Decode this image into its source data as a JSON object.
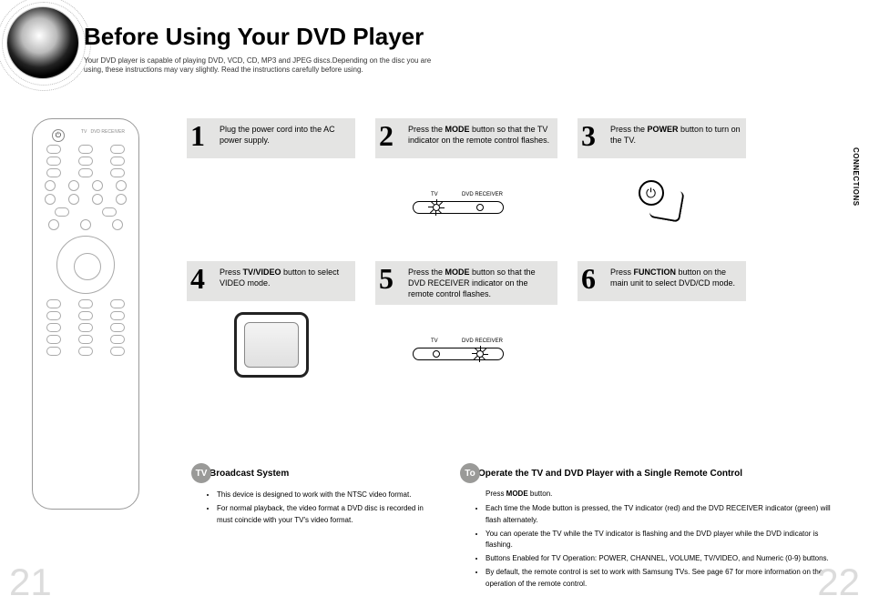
{
  "title": "Before Using Your DVD Player",
  "intro": "Your DVD player is capable of playing DVD, VCD, CD, MP3 and JPEG discs.Depending on the disc you are using, these instructions may vary slightly. Read the instructions carefully before using.",
  "side_tab": "CONNECTIONS",
  "indicator_labels": {
    "tv": "TV",
    "dvd": "DVD RECEIVER"
  },
  "steps": [
    {
      "num": "1",
      "text_pre": "Plug the power cord into the AC power supply.",
      "bold": "",
      "text_post": ""
    },
    {
      "num": "2",
      "text_pre": "Press the ",
      "bold": "MODE",
      "text_post": " button so that the TV indicator on the remote control flashes."
    },
    {
      "num": "3",
      "text_pre": "Press the ",
      "bold": "POWER",
      "text_post": " button to turn on the TV."
    },
    {
      "num": "4",
      "text_pre": "Press ",
      "bold": "TV/VIDEO",
      "text_post": " button to select VIDEO mode."
    },
    {
      "num": "5",
      "text_pre": "Press the ",
      "bold": "MODE",
      "text_post": " button so that the DVD RECEIVER indicator on the remote control flashes."
    },
    {
      "num": "6",
      "text_pre": "Press ",
      "bold": "FUNCTION",
      "text_post": " button on the main unit to select DVD/CD mode."
    }
  ],
  "tv_section": {
    "pill": "TV",
    "heading": " Broadcast System",
    "bullets": [
      "This device is designed to work with the NTSC video format.",
      "For normal playback, the video format a DVD disc is recorded in must coincide with your TV's video format."
    ]
  },
  "to_section": {
    "pill": "To",
    "heading": " Operate the TV and DVD Player with a Single Remote Control",
    "sub_pre": "Press ",
    "sub_bold": "MODE",
    "sub_post": " button.",
    "bullets": [
      "Each time the Mode button is pressed, the TV indicator (red) and the DVD RECEIVER indicator (green) will flash alternately.",
      "You can operate the TV while the TV indicator is flashing and the DVD player while the DVD indicator is flashing.",
      "Buttons Enabled for TV Operation: POWER, CHANNEL, VOLUME, TV/VIDEO, and Numeric (0-9) buttons.",
      "By default, the remote control is set to work with Samsung TVs.\nSee page 67 for more information on the operation of the remote control."
    ]
  },
  "page_left": "21",
  "page_right": "22"
}
